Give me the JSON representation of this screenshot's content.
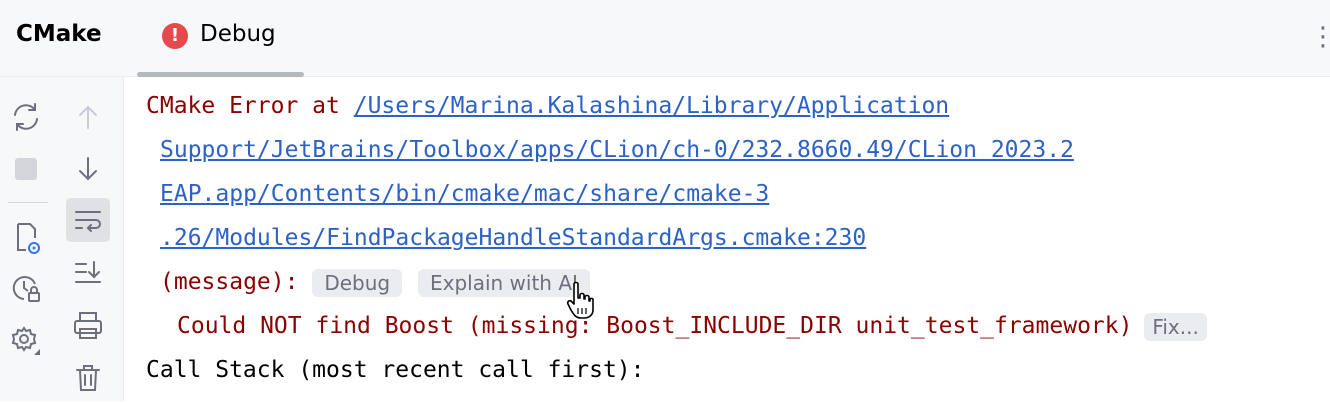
{
  "header": {
    "title": "CMake",
    "tab": {
      "label": "Debug",
      "icon": "error-icon",
      "icon_glyph": "!"
    },
    "more_glyph": "⋮"
  },
  "toolbar": {
    "left": [
      "reload-icon",
      "stop-icon",
      "settings-file-icon",
      "history-lock-icon",
      "gear-icon"
    ],
    "right": [
      "arrow-up-icon",
      "arrow-down-icon",
      "soft-wrap-icon",
      "scroll-to-end-icon",
      "print-icon",
      "trash-icon"
    ]
  },
  "console": {
    "prefix": "CMake Error at ",
    "path_lines": [
      "/Users/Marina.Kalashina/Library/Application ",
      "Support/JetBrains/Toolbox/apps/CLion/ch-0/232.8660.49/CLion 2023.2 ",
      "EAP.app/Contents/bin/cmake/mac/share/cmake-3",
      ".26/Modules/FindPackageHandleStandardArgs.cmake:230"
    ],
    "message_prefix": "(message):",
    "chip_debug": "Debug",
    "chip_explain": "Explain with AI",
    "error_text": "Could NOT find Boost (missing: Boost_INCLUDE_DIR unit_test_framework)",
    "chip_fix": "Fix...",
    "call_stack": "Call Stack (most recent call first):"
  },
  "colors": {
    "error": "#8b0000",
    "link": "#2c62c6",
    "badge": "#e5484d"
  }
}
